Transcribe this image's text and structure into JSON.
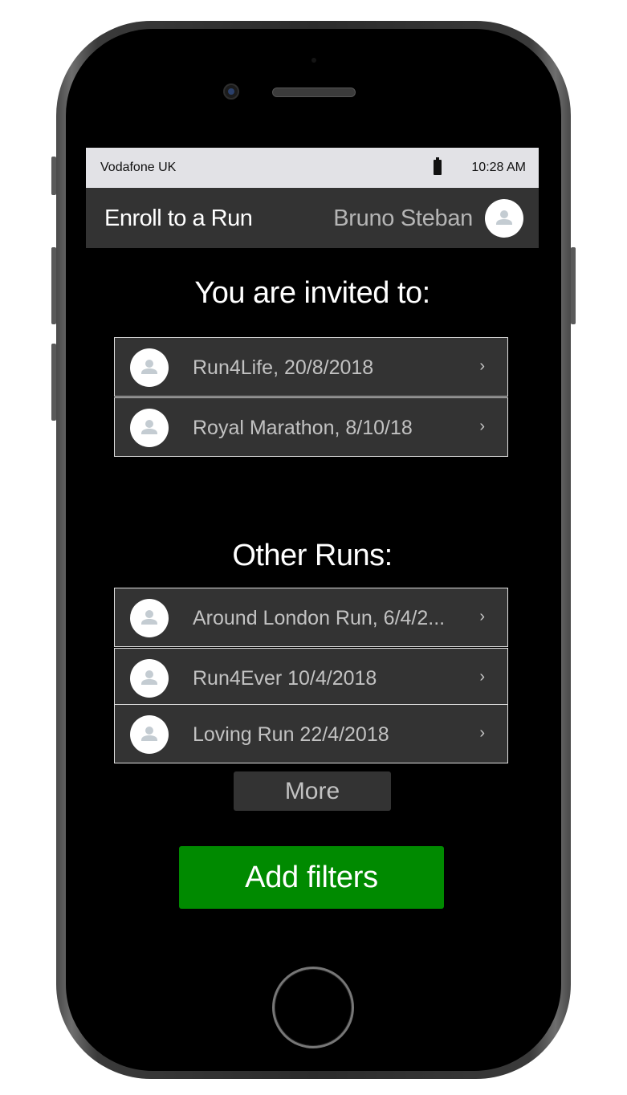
{
  "status_bar": {
    "carrier": "Vodafone UK",
    "time": "10:28 AM",
    "battery_icon": "battery-icon"
  },
  "header": {
    "title": "Enroll to a Run",
    "user_name": "Bruno Steban",
    "avatar_icon": "user-avatar-icon"
  },
  "invited": {
    "title": "You are invited to:",
    "items": [
      {
        "label": "Run4Life, 20/8/2018",
        "icon": "user-avatar-icon"
      },
      {
        "label": "Royal Marathon, 8/10/18",
        "icon": "user-avatar-icon"
      }
    ]
  },
  "other_runs": {
    "title": "Other Runs:",
    "items": [
      {
        "label": "Around London Run, 6/4/2...",
        "icon": "user-avatar-icon"
      },
      {
        "label": "Run4Ever 10/4/2018",
        "icon": "user-avatar-icon"
      },
      {
        "label": "Loving Run 22/4/2018",
        "icon": "user-avatar-icon"
      }
    ],
    "more_label": "More"
  },
  "actions": {
    "add_filters_label": "Add filters"
  },
  "colors": {
    "header_bg": "#333333",
    "status_bar_bg": "#e2e2e6",
    "accent_green": "#008a00",
    "list_bg": "#333333",
    "screen_bg": "#000000"
  }
}
